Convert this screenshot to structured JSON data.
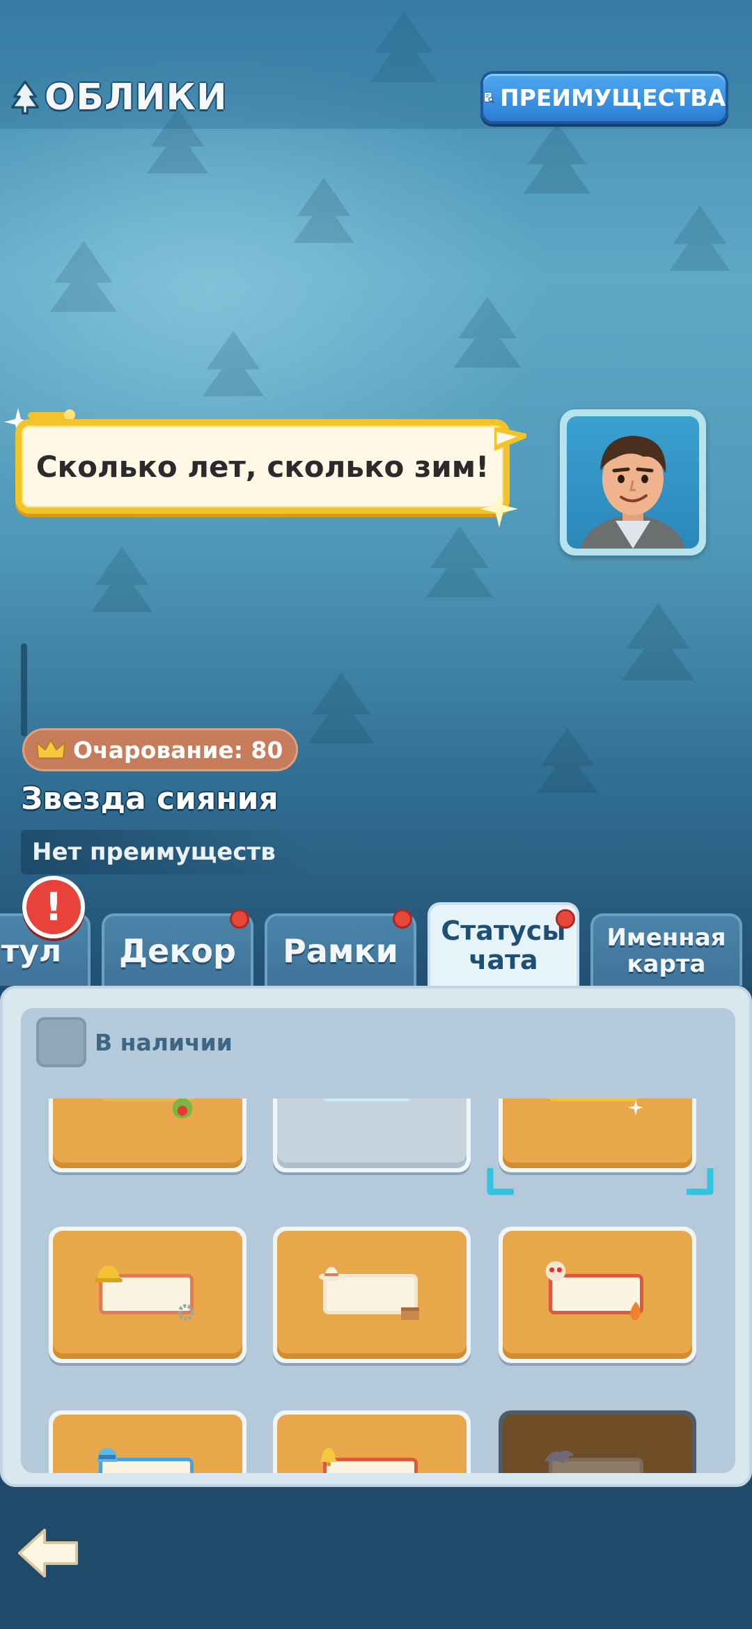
{
  "header": {
    "title": "ОБЛИКИ",
    "benefits_button": "ПРЕИМУЩЕСТВА"
  },
  "preview": {
    "chat_text": "Сколько лет, сколько зим!",
    "charm_label": "Очарование: 80",
    "skin_name": "Звезда сияния",
    "benefits_text": "Нет преимуществ"
  },
  "tabs": [
    {
      "label": "тул",
      "active": false,
      "dot": false
    },
    {
      "label": "Декор",
      "active": false,
      "dot": true
    },
    {
      "label": "Рамки",
      "active": false,
      "dot": true
    },
    {
      "label": "Статусы чата",
      "active": true,
      "dot": true
    },
    {
      "label": "Именная карта",
      "active": false,
      "dot": false
    }
  ],
  "alert_badge": "!",
  "filter": {
    "label": "В наличии",
    "checked": false
  },
  "colors": {
    "accent_gold": "#f3c32b",
    "card_orange": "#e8a74a",
    "button_blue": "#2b7fd4",
    "alert_red": "#e8433a",
    "selection_cyan": "#33c3e0"
  },
  "icons": {
    "title": "tree-icon",
    "benefits": "document-search-icon",
    "charm": "crown-icon",
    "back": "back-arrow-icon"
  }
}
